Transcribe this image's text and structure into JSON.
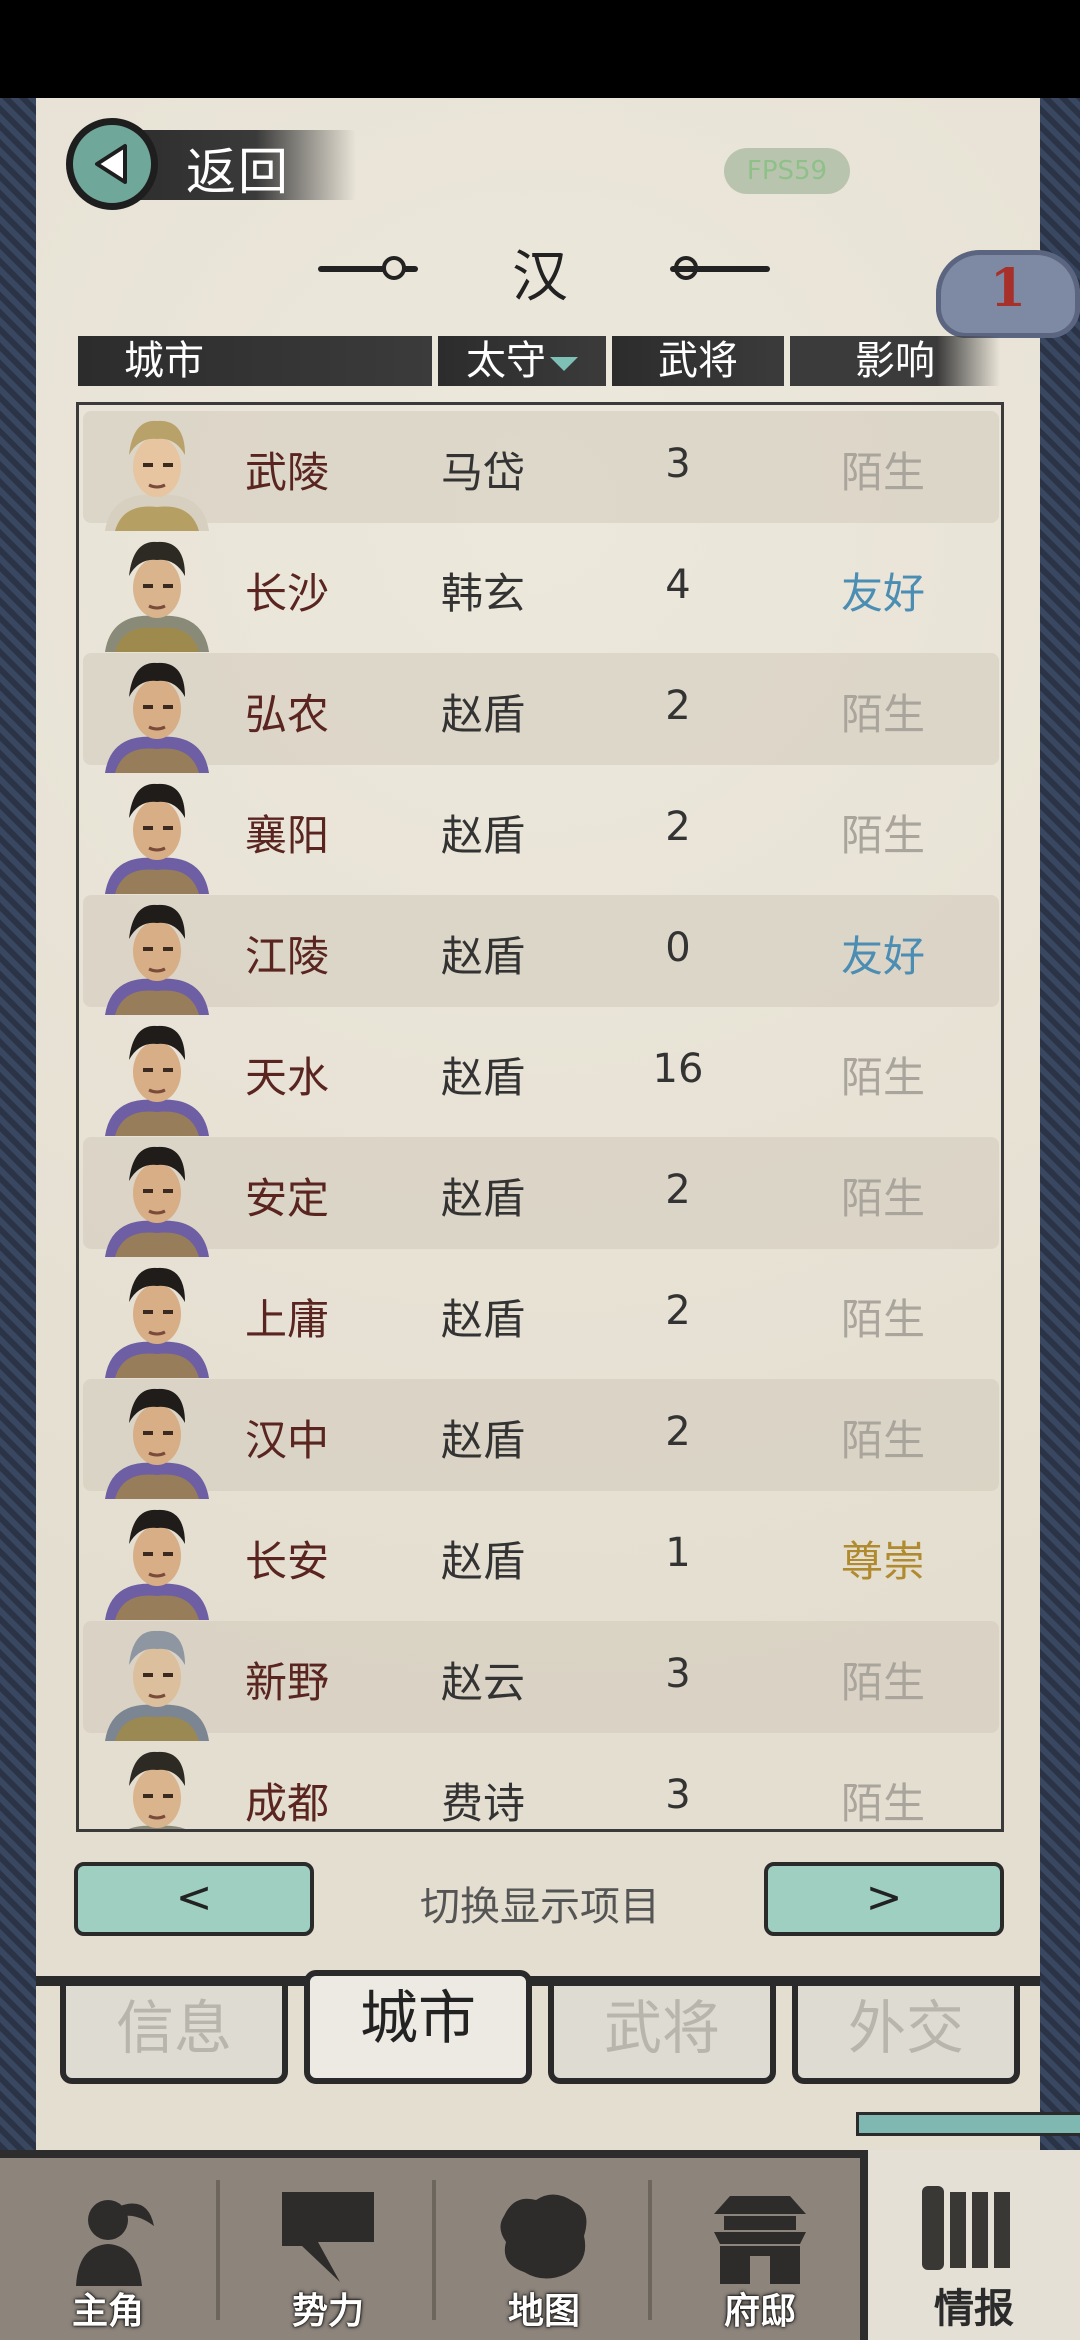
{
  "header": {
    "back_label": "返回",
    "fps": "FPS59",
    "faction": "汉",
    "notification_count": "1"
  },
  "columns": {
    "city": "城市",
    "governor": "太守",
    "generals": "武将",
    "influence": "影响"
  },
  "rows": [
    {
      "city": "武陵",
      "governor": "马岱",
      "generals": "3",
      "influence": "陌生",
      "influence_color": "#a9a59c"
    },
    {
      "city": "长沙",
      "governor": "韩玄",
      "generals": "4",
      "influence": "友好",
      "influence_color": "#4b8db3"
    },
    {
      "city": "弘农",
      "governor": "赵盾",
      "generals": "2",
      "influence": "陌生",
      "influence_color": "#a9a59c"
    },
    {
      "city": "襄阳",
      "governor": "赵盾",
      "generals": "2",
      "influence": "陌生",
      "influence_color": "#a9a59c"
    },
    {
      "city": "江陵",
      "governor": "赵盾",
      "generals": "0",
      "influence": "友好",
      "influence_color": "#4b8db3"
    },
    {
      "city": "天水",
      "governor": "赵盾",
      "generals": "16",
      "influence": "陌生",
      "influence_color": "#a9a59c"
    },
    {
      "city": "安定",
      "governor": "赵盾",
      "generals": "2",
      "influence": "陌生",
      "influence_color": "#a9a59c"
    },
    {
      "city": "上庸",
      "governor": "赵盾",
      "generals": "2",
      "influence": "陌生",
      "influence_color": "#a9a59c"
    },
    {
      "city": "汉中",
      "governor": "赵盾",
      "generals": "2",
      "influence": "陌生",
      "influence_color": "#a9a59c"
    },
    {
      "city": "长安",
      "governor": "赵盾",
      "generals": "1",
      "influence": "尊崇",
      "influence_color": "#b08a2e"
    },
    {
      "city": "新野",
      "governor": "赵云",
      "generals": "3",
      "influence": "陌生",
      "influence_color": "#a9a59c"
    },
    {
      "city": "成都",
      "governor": "费诗",
      "generals": "3",
      "influence": "陌生",
      "influence_color": "#a9a59c"
    }
  ],
  "switcher": {
    "prev": "<",
    "label": "切换显示项目",
    "next": ">"
  },
  "tabs": [
    "信息",
    "城市",
    "武将",
    "外交"
  ],
  "active_tab": "城市",
  "nav": [
    {
      "label": "主角",
      "icon": "hero-icon"
    },
    {
      "label": "势力",
      "icon": "flag-icon"
    },
    {
      "label": "地图",
      "icon": "map-icon"
    },
    {
      "label": "府邸",
      "icon": "mansion-icon"
    },
    {
      "label": "情报",
      "icon": "scroll-icon"
    }
  ],
  "active_nav": "情报"
}
